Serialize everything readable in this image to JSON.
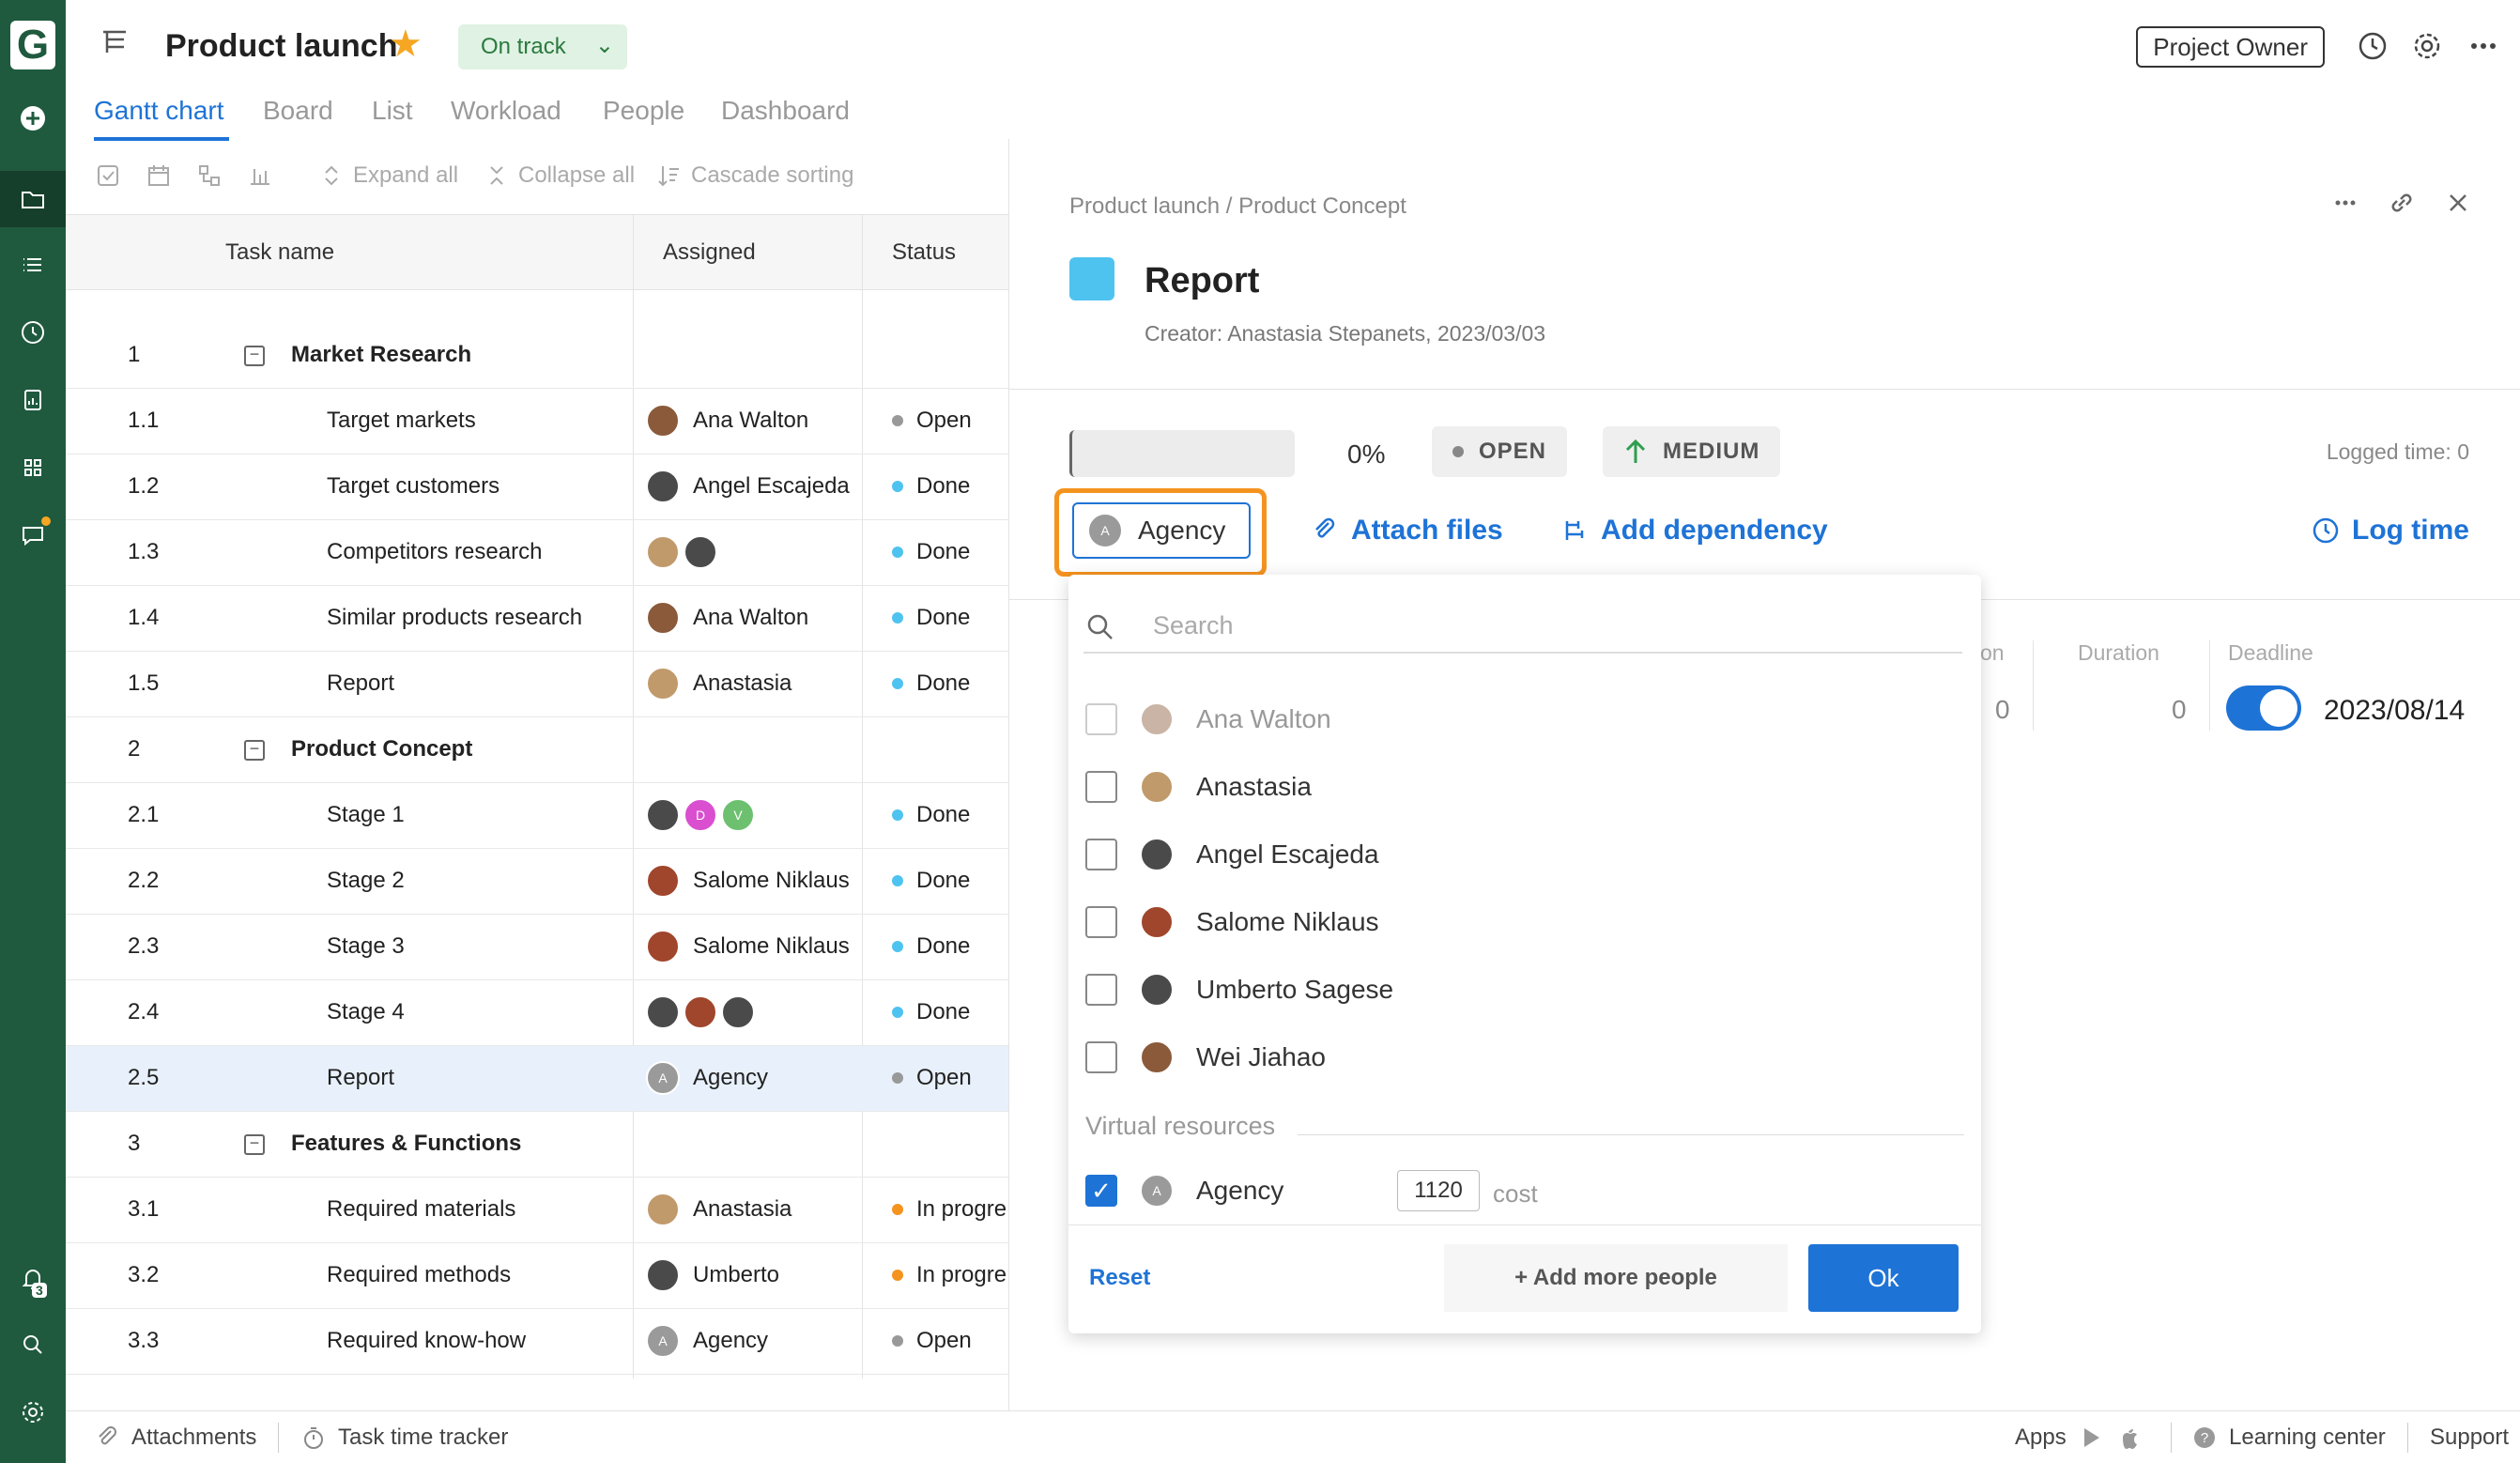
{
  "app": {
    "logo_letter": "G"
  },
  "header": {
    "title": "Product launch",
    "status": "On track",
    "role": "Project Owner"
  },
  "tabs": [
    "Gantt chart",
    "Board",
    "List",
    "Workload",
    "People",
    "Dashboard"
  ],
  "toolbar": {
    "expand_all": "Expand all",
    "collapse_all": "Collapse all",
    "cascade_sorting": "Cascade sorting"
  },
  "grid": {
    "columns": {
      "task_name": "Task name",
      "assigned": "Assigned",
      "status": "Status"
    },
    "rows": [
      {
        "num": "1",
        "name": "Market Research",
        "group": true,
        "assigned": "",
        "status": ""
      },
      {
        "num": "1.1",
        "name": "Target markets",
        "assigned": "Ana Walton",
        "status": "Open"
      },
      {
        "num": "1.2",
        "name": "Target customers",
        "assigned": "Angel Escajeda",
        "status": "Done"
      },
      {
        "num": "1.3",
        "name": "Competitors research",
        "assigned": "",
        "status": "Done"
      },
      {
        "num": "1.4",
        "name": "Similar products research",
        "assigned": "Ana Walton",
        "status": "Done"
      },
      {
        "num": "1.5",
        "name": "Report",
        "assigned": "Anastasia",
        "status": "Done"
      },
      {
        "num": "2",
        "name": "Product Concept",
        "group": true,
        "assigned": "",
        "status": ""
      },
      {
        "num": "2.1",
        "name": "Stage 1",
        "assigned": "",
        "status": "Done"
      },
      {
        "num": "2.2",
        "name": "Stage 2",
        "assigned": "Salome Niklaus",
        "status": "Done"
      },
      {
        "num": "2.3",
        "name": "Stage 3",
        "assigned": "Salome Niklaus",
        "status": "Done"
      },
      {
        "num": "2.4",
        "name": "Stage 4",
        "assigned": "",
        "status": "Done"
      },
      {
        "num": "2.5",
        "name": "Report",
        "assigned": "Agency",
        "status": "Open"
      },
      {
        "num": "3",
        "name": "Features & Functions",
        "group": true,
        "assigned": "",
        "status": ""
      },
      {
        "num": "3.1",
        "name": "Required materials",
        "assigned": "Anastasia",
        "status": "In progre"
      },
      {
        "num": "3.2",
        "name": "Required methods",
        "assigned": "Umberto",
        "status": "In progre"
      },
      {
        "num": "3.3",
        "name": "Required know-how",
        "assigned": "Agency",
        "status": "Open"
      },
      {
        "num": "3.4",
        "name": "Required team",
        "assigned": "",
        "status": "Open"
      },
      {
        "num": "4",
        "name": "Strategic Features",
        "group": true,
        "assigned": "",
        "status": ""
      }
    ],
    "avatar_letters": {
      "d": "D",
      "v": "V",
      "a": "A"
    }
  },
  "panel": {
    "breadcrumb": "Product launch / Product Concept",
    "task_title": "Report",
    "creator": "Creator: Anastasia Stepanets, 2023/03/03",
    "progress_pct": "0%",
    "status_chip": "OPEN",
    "priority_chip": "MEDIUM",
    "logged_time": "Logged time: 0",
    "assignee": "Agency",
    "attach_files": "Attach files",
    "add_dependency": "Add dependency",
    "log_time": "Log time",
    "fields": {
      "partial_label": "on",
      "partial_value": "0",
      "duration_label": "Duration",
      "duration_value": "0",
      "deadline_label": "Deadline",
      "deadline_value": "2023/08/14"
    }
  },
  "dropdown": {
    "search_placeholder": "Search",
    "people": [
      "Ana Walton",
      "Anastasia",
      "Angel Escajeda",
      "Salome Niklaus",
      "Umberto Sagese",
      "Wei Jiahao"
    ],
    "virtual_section": "Virtual resources",
    "virtual": {
      "name": "Agency",
      "cost": "1120",
      "cost_label": "cost",
      "checked": true
    },
    "reset": "Reset",
    "add_more": "+ Add more people",
    "ok": "Ok"
  },
  "footer": {
    "attachments": "Attachments",
    "time_tracker": "Task time tracker",
    "apps": "Apps",
    "learning_center": "Learning center",
    "support": "Support"
  },
  "notifications_count": "3",
  "colors": {
    "brand_green": "#1f5a3e",
    "accent_blue": "#1e73d6",
    "highlight_orange": "#f5931f",
    "task_color": "#4ec3f0"
  }
}
